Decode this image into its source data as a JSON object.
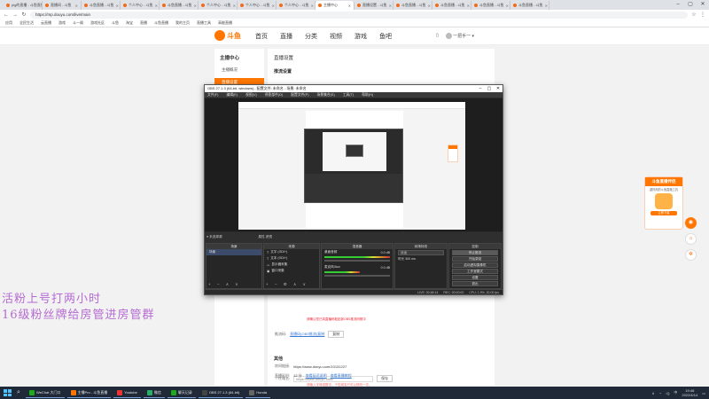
{
  "browser": {
    "tabs": [
      {
        "label": "pig的直播 - 斗鱼直播"
      },
      {
        "label": "直播间 - 斗鱼"
      },
      {
        "label": "斗鱼直播 - 斗鱼"
      },
      {
        "label": "个人中心 - 斗鱼"
      },
      {
        "label": "斗鱼直播 - 斗鱼"
      },
      {
        "label": "个人中心 - 斗鱼"
      },
      {
        "label": "个人中心 - 斗鱼"
      },
      {
        "label": "个人中心 - 斗鱼"
      },
      {
        "label": "主播中心",
        "active": true
      },
      {
        "label": "直播设置 - 斗鱼"
      },
      {
        "label": "斗鱼直播 - 斗鱼"
      },
      {
        "label": "斗鱼直播 - 斗鱼"
      },
      {
        "label": "斗鱼直播 - 斗鱼"
      },
      {
        "label": "斗鱼直播 - 斗鱼"
      }
    ],
    "url": "https://mp.douyu.com/live/main",
    "bookmarks": [
      "应用",
      "全民生活",
      "云直播",
      "游戏",
      "斗一阁",
      "游戏社区",
      "斗鱼",
      "淘宝",
      "直播",
      "斗鱼直播",
      "我的主页",
      "直播工具",
      "高能直播"
    ]
  },
  "site": {
    "logo_text": "斗鱼",
    "nav": [
      "首页",
      "直播",
      "分类",
      "视频",
      "游戏",
      "鱼吧"
    ],
    "user_name": "一把手一",
    "left": {
      "head": "主播中心",
      "items": [
        "主播概况",
        "直播设置"
      ]
    },
    "main": {
      "title": "直播设置",
      "section": "推流设置",
      "hint_red": "请确认您已将直播码粘贴到OBS推流码框中",
      "push_label": "推流码:",
      "push_link": "直播码(OBS推流)复制",
      "push_btn": "复制",
      "other_title": "其他",
      "room_label": "房间链接:",
      "room_url": "https://www.douyu.com/10131227",
      "custom_label": "个性域名:",
      "custom_input": "https://www.douyu.com/",
      "custom_btn": "保存",
      "custom_hint": "请输入字母或数字，个性域名只可以修改一次。",
      "delay_label": "直播延时:",
      "delay_value": "12 分",
      "delay_link1": "查看延迟说明",
      "delay_link2": "查看直播教程"
    },
    "promo": {
      "title": "斗鱼直播伴侣",
      "desc": "超好用的斗鱼直播工具",
      "button": "立即下载"
    }
  },
  "overlay": {
    "line1": "活粉上号打两小时",
    "line2": "16级粉丝牌给房管进房管群"
  },
  "obs": {
    "title": "OBS 27.1.3 (64-bit, windows) - 配置文件: 未命名 - 场景: 未命名",
    "menu": [
      "文件(F)",
      "编辑(E)",
      "视图(V)",
      "停靠部件(D)",
      "配置文件(P)",
      "场景集合(S)",
      "工具(T)",
      "帮助(H)"
    ],
    "scene_header": "● 未选择源",
    "scene_tabs": "属性  滤镜",
    "docks": {
      "scenes": {
        "title": "场景",
        "items": [
          "场景"
        ]
      },
      "sources": {
        "title": "来源",
        "items": [
          "文字 (GDI+)",
          "文本 (GDI+)",
          "显示器采集",
          "窗口采集"
        ]
      },
      "mixer": {
        "title": "混音器",
        "tracks": [
          {
            "name": "桌面音频",
            "db": "0.0 dB"
          },
          {
            "name": "麦克风/Aux",
            "db": "0.0 dB"
          }
        ]
      },
      "transitions": {
        "title": "转场特效",
        "type": "淡出",
        "duration": "时长 300 ms"
      },
      "controls": {
        "title": "控制",
        "buttons": [
          "停止推流",
          "开始录制",
          "启动虚拟摄像机",
          "工作室模式",
          "设置",
          "退出"
        ]
      }
    },
    "status": [
      "LIVE: 00:48:14",
      "REC: 00:00:00",
      "CPU: 1.9%, 30.00 fps"
    ]
  },
  "taskbar": {
    "items": [
      {
        "label": "WeChat 大门口",
        "color": "#1aad19"
      },
      {
        "label": "主播Pro - 斗鱼直播",
        "color": "#ff7700"
      },
      {
        "label": "Youtube",
        "color": "#e33"
      },
      {
        "label": "微信",
        "color": "#2aae67"
      },
      {
        "label": "聊天记录",
        "color": "#1aad19"
      },
      {
        "label": "OBS 27.1.3 (64-bit)",
        "color": "#444"
      },
      {
        "label": "Honda",
        "color": "#666"
      }
    ],
    "time": "19:48",
    "date": "2022/4/14",
    "lang": "中"
  }
}
